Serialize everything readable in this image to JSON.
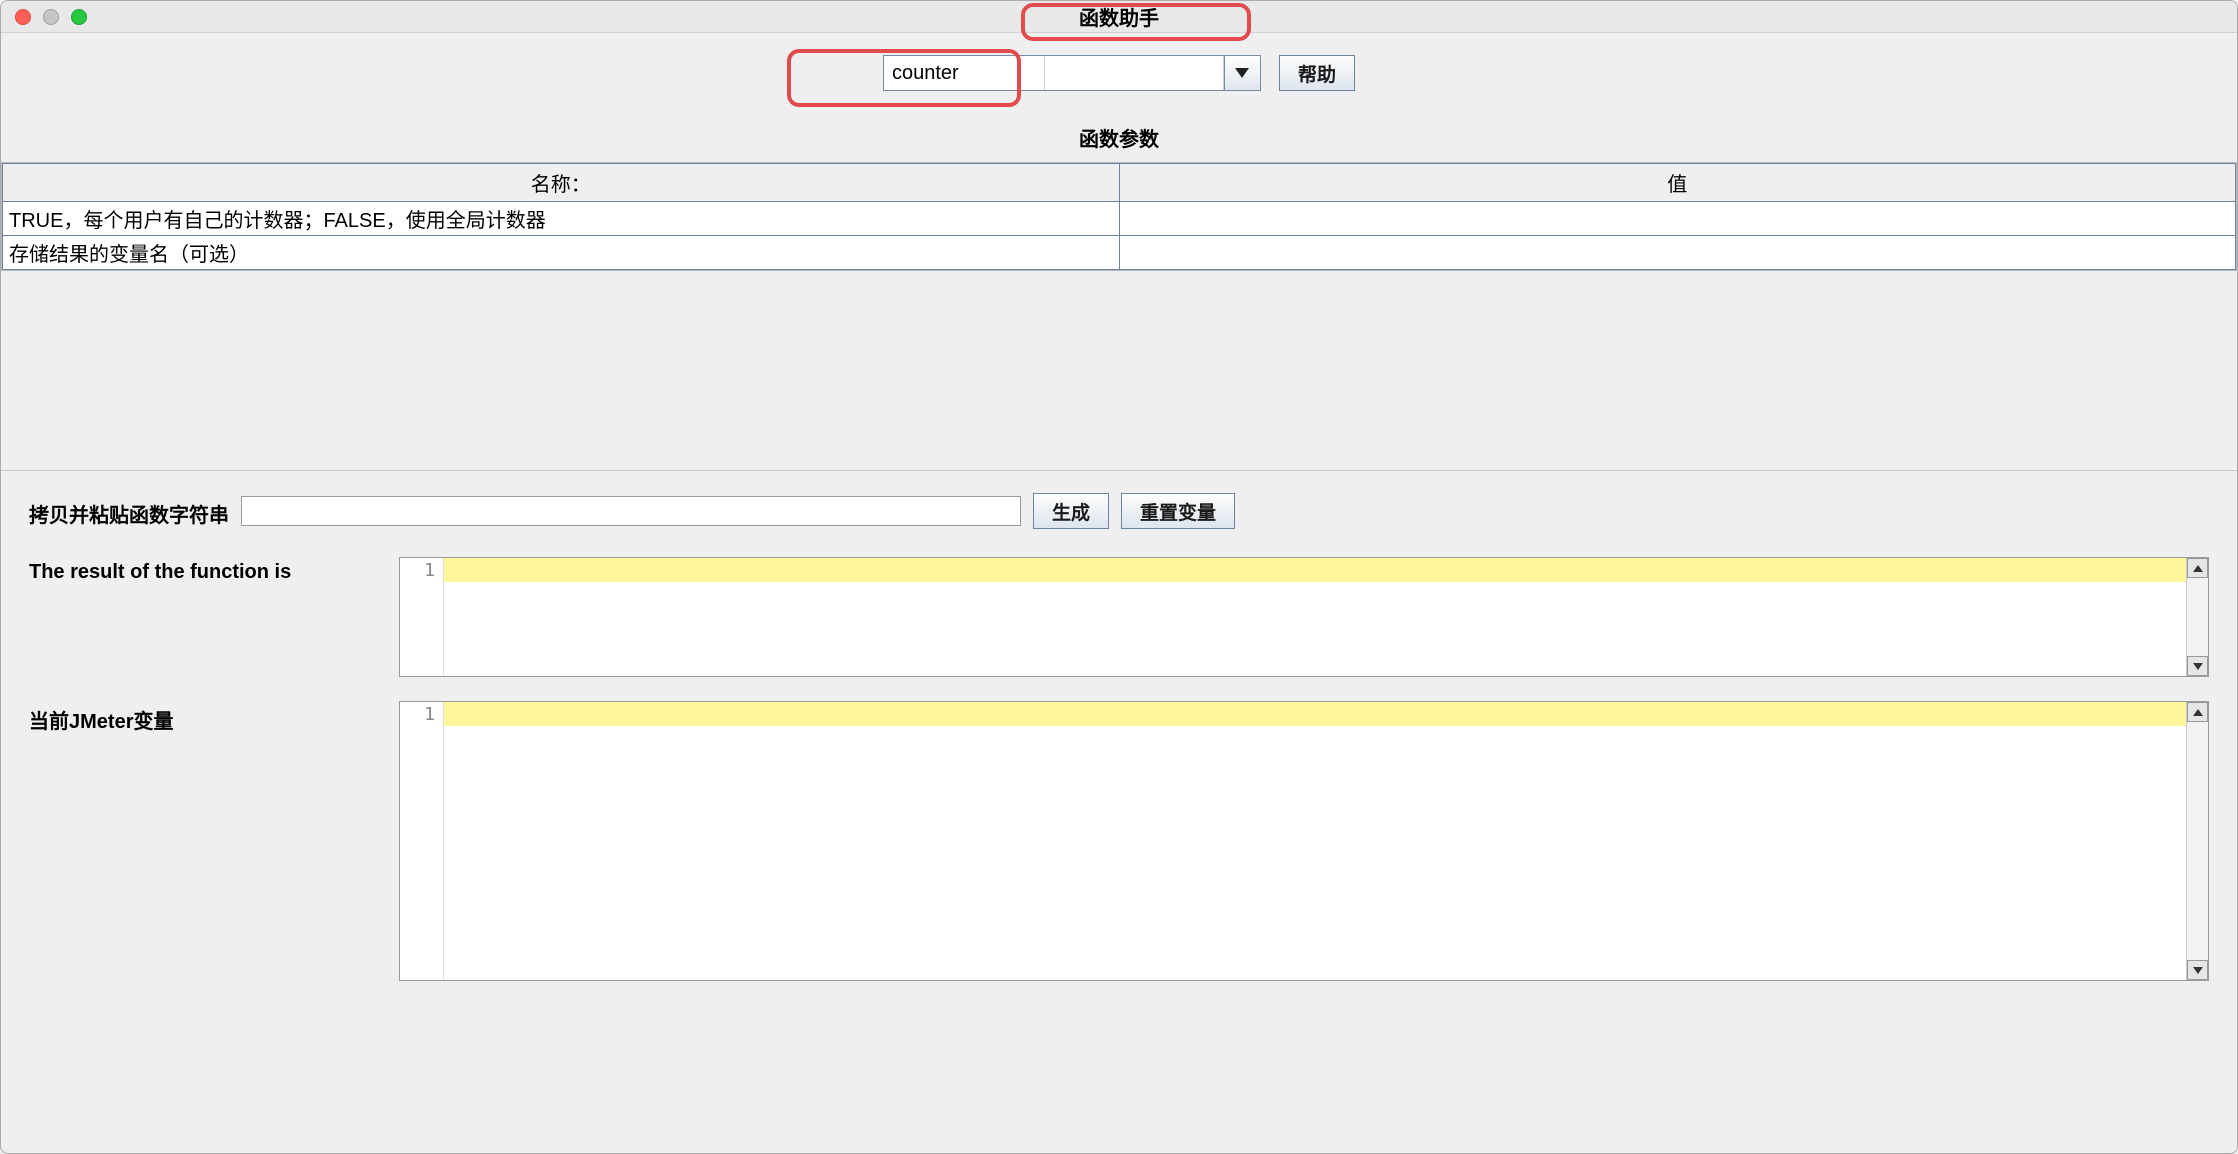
{
  "window": {
    "title": "函数助手"
  },
  "toolbar": {
    "function_name": "counter",
    "help_button": "帮助"
  },
  "params": {
    "section_title": "函数参数",
    "columns": {
      "name": "名称：",
      "value": "值"
    },
    "rows": [
      {
        "name": "TRUE，每个用户有自己的计数器；FALSE，使用全局计数器",
        "value": ""
      },
      {
        "name": "存储结果的变量名（可选）",
        "value": ""
      }
    ]
  },
  "generate": {
    "label": "拷贝并粘贴函数字符串",
    "value": "",
    "generate_button": "生成",
    "reset_button": "重置变量"
  },
  "result": {
    "label": "The result of the function is",
    "line_number": "1",
    "content": ""
  },
  "vars": {
    "label": "当前JMeter变量",
    "line_number": "1",
    "content": ""
  },
  "annotations": {
    "color": "#e24b4b"
  }
}
